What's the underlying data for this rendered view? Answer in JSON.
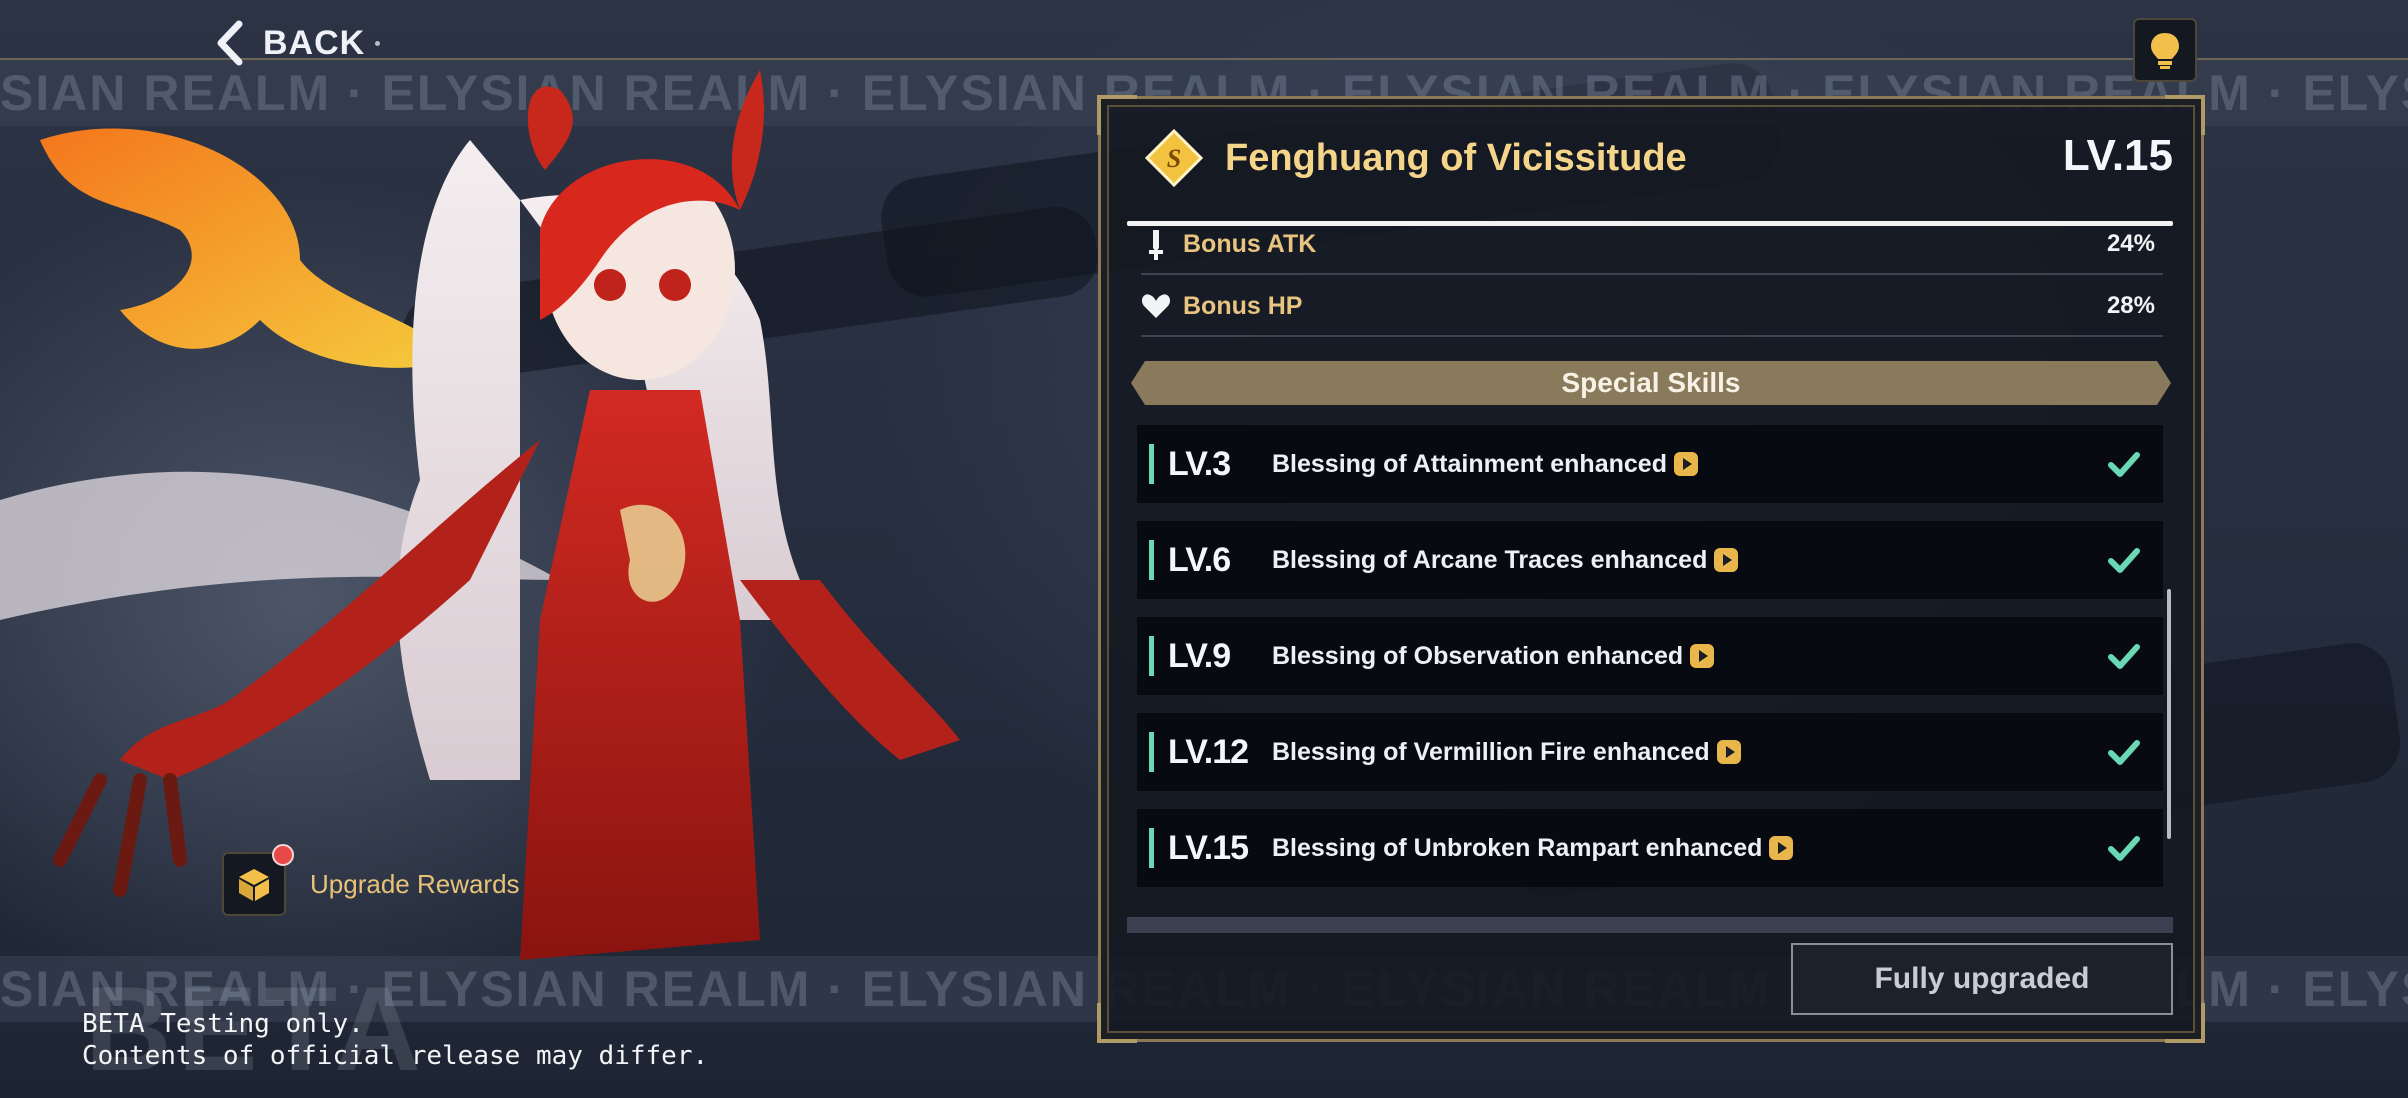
{
  "nav": {
    "back_label": "BACK"
  },
  "banner": {
    "watermark_text": "SIAN REALM · ELYSIAN REALM · ELYSIAN REALM · ELYSIAN REALM · ELYSIAN REALM · ELYSIAN REALM",
    "beta_watermark": "BETA"
  },
  "upgrade_rewards": {
    "label": "Upgrade Rewards"
  },
  "beta_notice": {
    "line1": "BETA Testing only.",
    "line2": "Contents of official release may differ."
  },
  "panel": {
    "rank": "S",
    "title": "Fenghuang of Vicissitude",
    "level": "LV.15",
    "stats": [
      {
        "label": "Bonus ATK",
        "value": "24%",
        "icon": "sword-icon"
      },
      {
        "label": "Bonus HP",
        "value": "28%",
        "icon": "heart-icon"
      }
    ],
    "skills_header": "Special Skills",
    "skills": [
      {
        "level": "LV.3",
        "name": "Blessing of Attainment enhanced"
      },
      {
        "level": "LV.6",
        "name": "Blessing of Arcane Traces enhanced"
      },
      {
        "level": "LV.9",
        "name": "Blessing of Observation enhanced"
      },
      {
        "level": "LV.12",
        "name": "Blessing of Vermillion Fire enhanced"
      },
      {
        "level": "LV.15",
        "name": "Blessing of Unbroken Rampart enhanced"
      }
    ],
    "fully_upgraded_label": "Fully upgraded"
  },
  "colors": {
    "accent_gold": "#f5d58a",
    "check_green": "#6ad8b4",
    "panel_bg": "#141821"
  }
}
